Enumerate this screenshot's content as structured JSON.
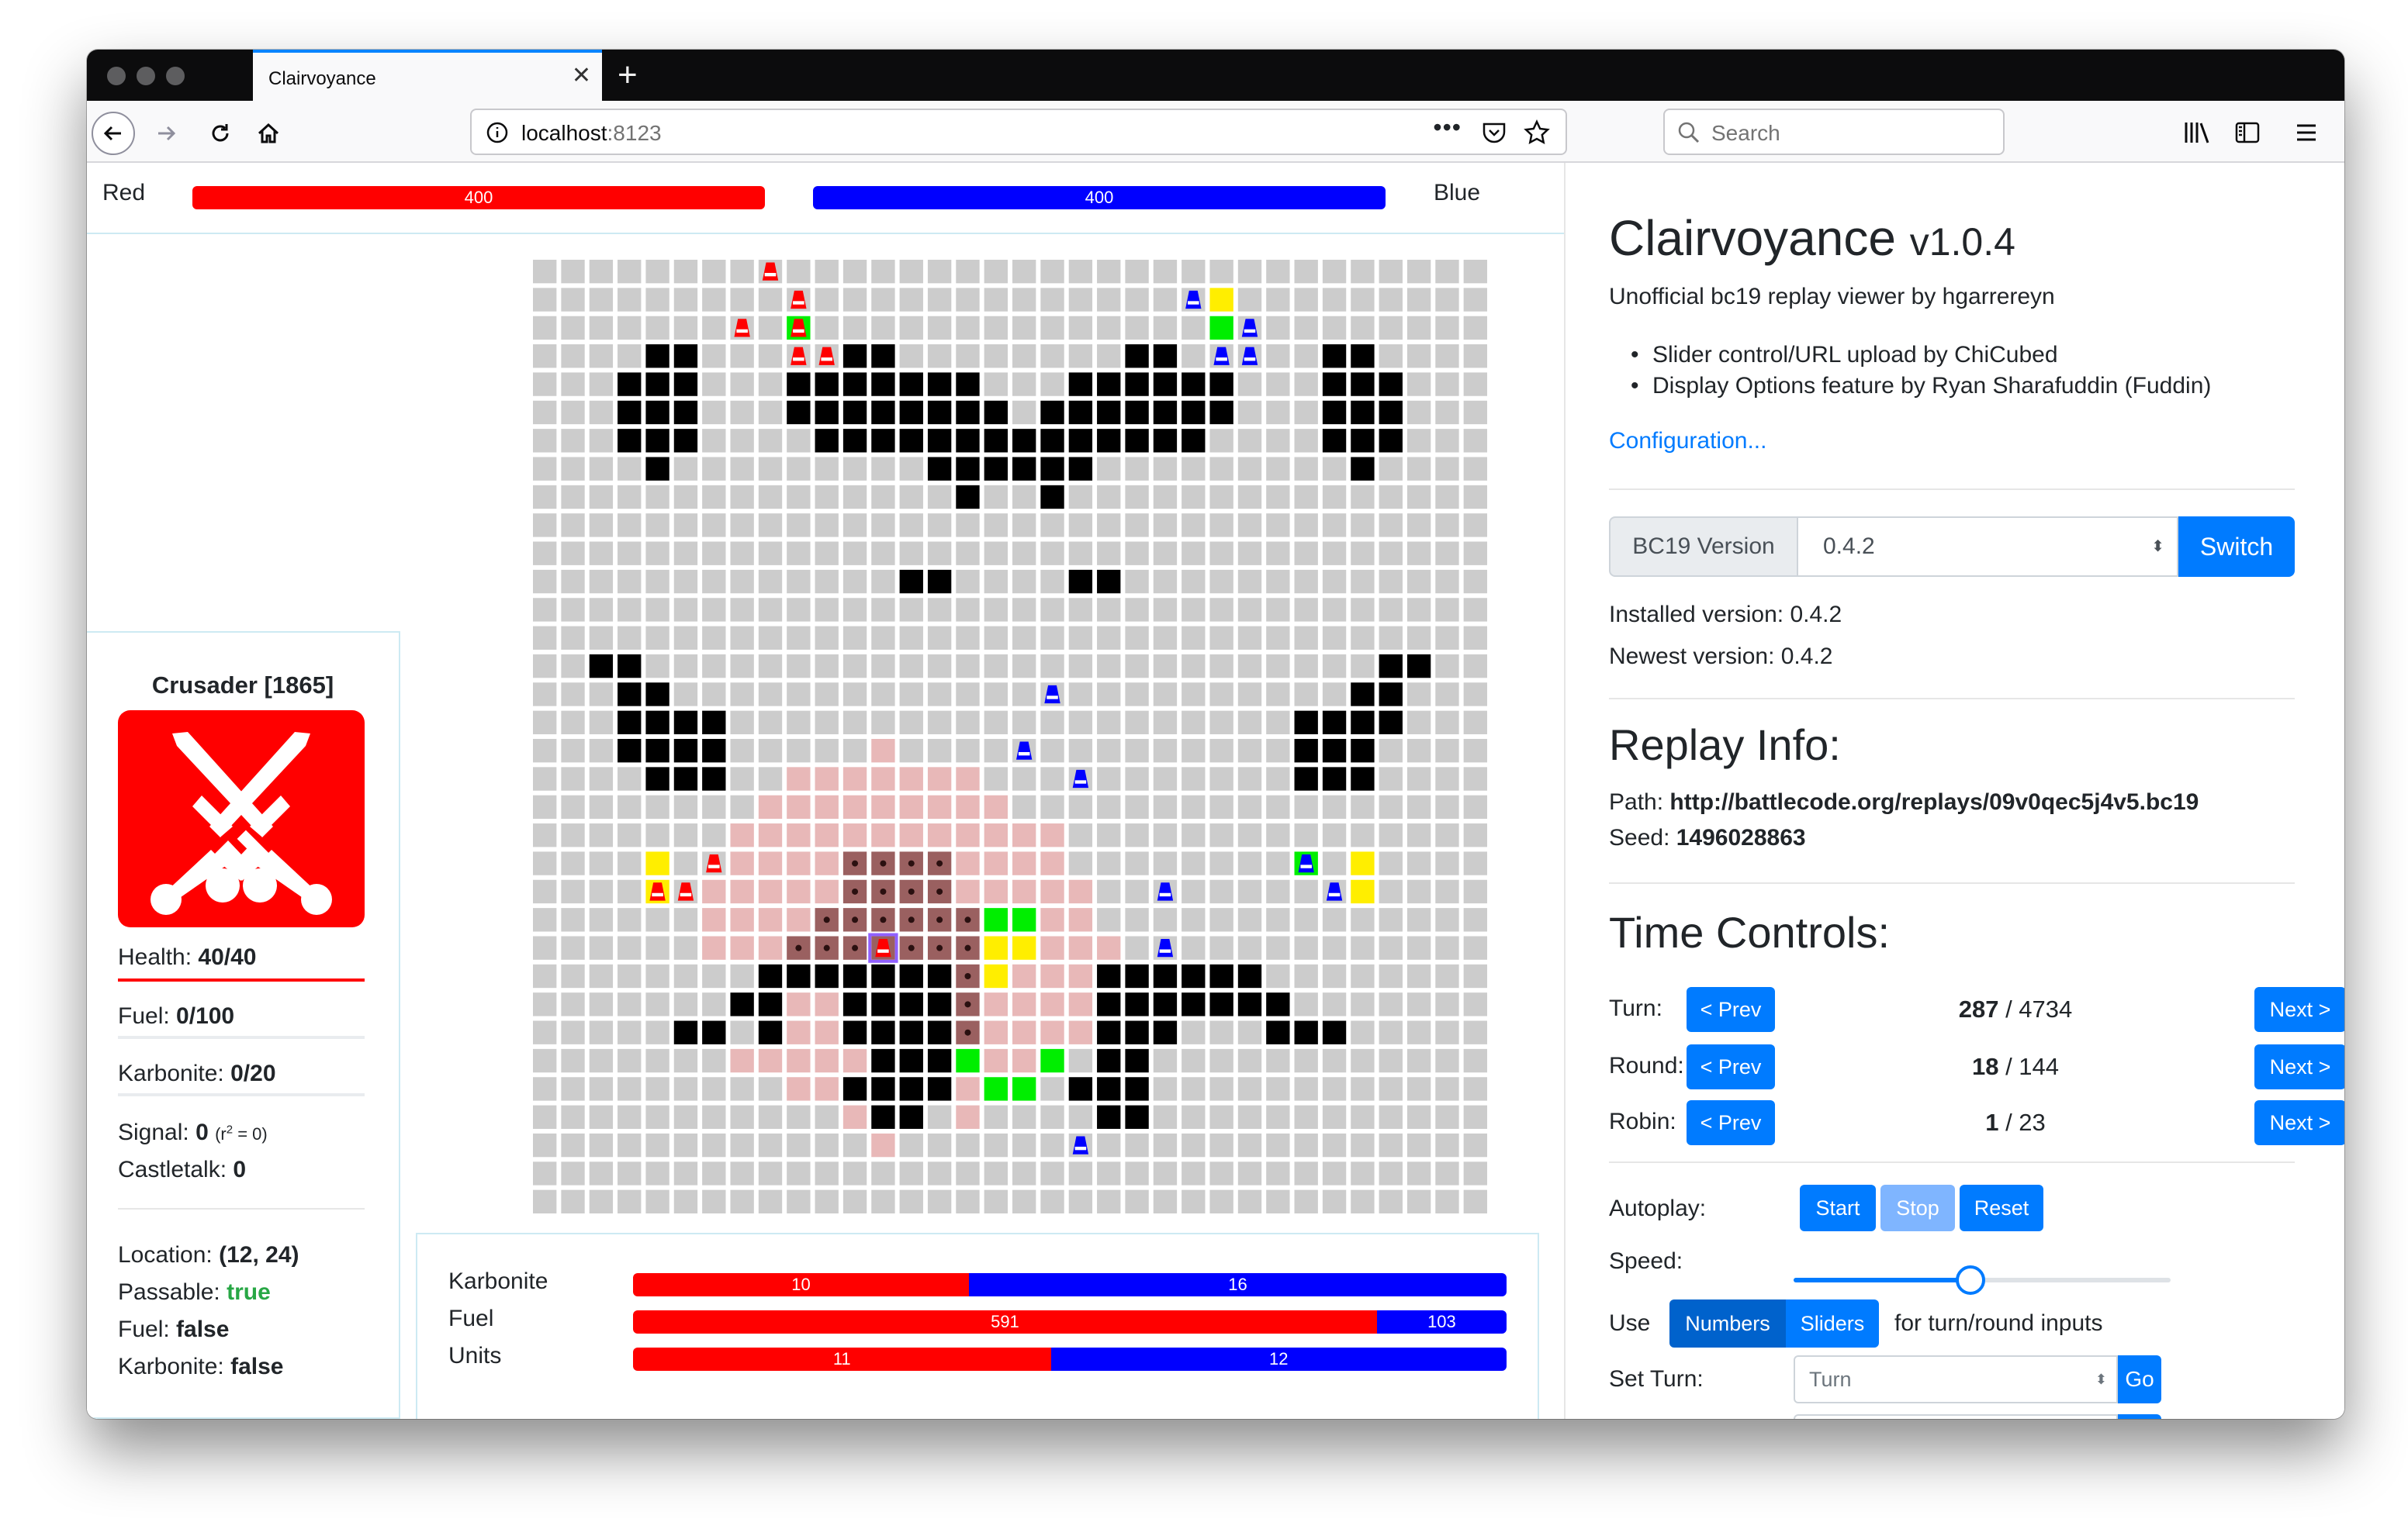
{
  "browser": {
    "tab_title": "Clairvoyance",
    "url_host": "localhost",
    "url_port": ":8123",
    "search_placeholder": "Search",
    "accent": "#0a84ff"
  },
  "health": {
    "red_label": "Red",
    "blue_label": "Blue",
    "red_value": "400",
    "blue_value": "400",
    "red_color": "#ff0000",
    "blue_color": "#0000ff"
  },
  "robot": {
    "title": "Crusader [1865]",
    "icon": "crossed-swords-icon",
    "health_label": "Health:",
    "health_value": "40/40",
    "fuel_label": "Fuel:",
    "fuel_value": "0/100",
    "karbonite_label": "Karbonite:",
    "karbonite_value": "0/20",
    "signal_label": "Signal:",
    "signal_value": "0",
    "signal_note": "(r",
    "signal_note_sup": "2",
    "signal_note_end": " = 0)",
    "castletalk_label": "Castletalk:",
    "castletalk_value": "0",
    "location_label": "Location:",
    "location_value": "(12, 24)",
    "passable_label": "Passable:",
    "passable_value": "true",
    "tile_fuel_label": "Fuel:",
    "tile_fuel_value": "false",
    "tile_karbonite_label": "Karbonite:",
    "tile_karbonite_value": "false"
  },
  "resources": {
    "rows": [
      {
        "label": "Karbonite",
        "red": 10,
        "blue": 16
      },
      {
        "label": "Fuel",
        "red": 591,
        "blue": 103
      },
      {
        "label": "Units",
        "red": 11,
        "blue": 12
      }
    ]
  },
  "map": {
    "size": 34,
    "colors": {
      "empty": "#cccccc",
      "wall": "#000000",
      "red_zone": "#e8b8b8",
      "red_zone_dark": "#9a6060",
      "karbonite": "#00ee00",
      "fuel": "#ffee00",
      "red_unit": "#ff0000",
      "blue_unit": "#0000ff",
      "highlight": "#9060ff"
    },
    "walls": [
      [
        3,
        4
      ],
      [
        3,
        5
      ],
      [
        4,
        3
      ],
      [
        4,
        4
      ],
      [
        4,
        5
      ],
      [
        5,
        3
      ],
      [
        5,
        4
      ],
      [
        5,
        5
      ],
      [
        6,
        3
      ],
      [
        6,
        4
      ],
      [
        6,
        5
      ],
      [
        7,
        4
      ],
      [
        3,
        11
      ],
      [
        3,
        12
      ],
      [
        4,
        9
      ],
      [
        4,
        10
      ],
      [
        4,
        11
      ],
      [
        4,
        12
      ],
      [
        4,
        13
      ],
      [
        4,
        14
      ],
      [
        4,
        15
      ],
      [
        5,
        9
      ],
      [
        5,
        10
      ],
      [
        5,
        11
      ],
      [
        5,
        12
      ],
      [
        5,
        13
      ],
      [
        5,
        14
      ],
      [
        5,
        15
      ],
      [
        5,
        16
      ],
      [
        6,
        10
      ],
      [
        6,
        11
      ],
      [
        6,
        12
      ],
      [
        6,
        13
      ],
      [
        6,
        14
      ],
      [
        6,
        15
      ],
      [
        6,
        16
      ],
      [
        6,
        17
      ],
      [
        7,
        14
      ],
      [
        7,
        15
      ],
      [
        7,
        16
      ],
      [
        7,
        17
      ],
      [
        7,
        18
      ],
      [
        7,
        19
      ],
      [
        8,
        15
      ],
      [
        8,
        18
      ],
      [
        3,
        21
      ],
      [
        3,
        22
      ],
      [
        4,
        19
      ],
      [
        4,
        20
      ],
      [
        4,
        21
      ],
      [
        4,
        22
      ],
      [
        4,
        23
      ],
      [
        4,
        24
      ],
      [
        5,
        18
      ],
      [
        5,
        19
      ],
      [
        5,
        20
      ],
      [
        5,
        21
      ],
      [
        5,
        22
      ],
      [
        5,
        23
      ],
      [
        5,
        24
      ],
      [
        6,
        17
      ],
      [
        6,
        18
      ],
      [
        6,
        19
      ],
      [
        6,
        20
      ],
      [
        6,
        21
      ],
      [
        6,
        22
      ],
      [
        6,
        23
      ],
      [
        3,
        28
      ],
      [
        3,
        29
      ],
      [
        4,
        28
      ],
      [
        4,
        29
      ],
      [
        4,
        30
      ],
      [
        5,
        28
      ],
      [
        5,
        29
      ],
      [
        5,
        30
      ],
      [
        6,
        28
      ],
      [
        6,
        29
      ],
      [
        6,
        30
      ],
      [
        7,
        29
      ],
      [
        11,
        13
      ],
      [
        11,
        14
      ],
      [
        11,
        19
      ],
      [
        11,
        20
      ],
      [
        14,
        2
      ],
      [
        14,
        3
      ],
      [
        15,
        3
      ],
      [
        15,
        4
      ],
      [
        16,
        3
      ],
      [
        16,
        4
      ],
      [
        16,
        5
      ],
      [
        16,
        6
      ],
      [
        17,
        3
      ],
      [
        17,
        4
      ],
      [
        17,
        5
      ],
      [
        17,
        6
      ],
      [
        18,
        4
      ],
      [
        18,
        5
      ],
      [
        18,
        6
      ],
      [
        14,
        30
      ],
      [
        14,
        31
      ],
      [
        15,
        29
      ],
      [
        15,
        30
      ],
      [
        16,
        27
      ],
      [
        16,
        28
      ],
      [
        16,
        29
      ],
      [
        16,
        30
      ],
      [
        17,
        27
      ],
      [
        17,
        28
      ],
      [
        17,
        29
      ],
      [
        18,
        27
      ],
      [
        18,
        28
      ],
      [
        18,
        29
      ],
      [
        25,
        8
      ],
      [
        25,
        9
      ],
      [
        25,
        10
      ],
      [
        25,
        11
      ],
      [
        25,
        12
      ],
      [
        25,
        13
      ],
      [
        25,
        14
      ],
      [
        26,
        7
      ],
      [
        26,
        8
      ],
      [
        26,
        11
      ],
      [
        26,
        12
      ],
      [
        26,
        13
      ],
      [
        26,
        14
      ],
      [
        27,
        5
      ],
      [
        27,
        6
      ],
      [
        27,
        8
      ],
      [
        27,
        11
      ],
      [
        27,
        12
      ],
      [
        27,
        13
      ],
      [
        27,
        14
      ],
      [
        28,
        12
      ],
      [
        28,
        13
      ],
      [
        28,
        14
      ],
      [
        29,
        11
      ],
      [
        29,
        12
      ],
      [
        29,
        13
      ],
      [
        29,
        14
      ],
      [
        30,
        12
      ],
      [
        30,
        13
      ],
      [
        25,
        20
      ],
      [
        25,
        21
      ],
      [
        25,
        22
      ],
      [
        25,
        23
      ],
      [
        25,
        24
      ],
      [
        25,
        25
      ],
      [
        26,
        20
      ],
      [
        26,
        21
      ],
      [
        26,
        22
      ],
      [
        26,
        23
      ],
      [
        26,
        24
      ],
      [
        26,
        25
      ],
      [
        26,
        26
      ],
      [
        27,
        20
      ],
      [
        27,
        21
      ],
      [
        27,
        22
      ],
      [
        27,
        26
      ],
      [
        27,
        27
      ],
      [
        27,
        28
      ],
      [
        28,
        20
      ],
      [
        28,
        21
      ],
      [
        29,
        19
      ],
      [
        29,
        20
      ],
      [
        29,
        21
      ],
      [
        30,
        20
      ],
      [
        30,
        21
      ]
    ],
    "red_zone": [
      [
        17,
        12
      ],
      [
        18,
        9
      ],
      [
        18,
        10
      ],
      [
        18,
        11
      ],
      [
        18,
        12
      ],
      [
        18,
        13
      ],
      [
        18,
        14
      ],
      [
        18,
        15
      ],
      [
        19,
        8
      ],
      [
        19,
        9
      ],
      [
        19,
        10
      ],
      [
        19,
        11
      ],
      [
        19,
        12
      ],
      [
        19,
        13
      ],
      [
        19,
        14
      ],
      [
        19,
        15
      ],
      [
        19,
        16
      ],
      [
        20,
        7
      ],
      [
        20,
        8
      ],
      [
        20,
        9
      ],
      [
        20,
        10
      ],
      [
        20,
        11
      ],
      [
        20,
        12
      ],
      [
        20,
        13
      ],
      [
        20,
        14
      ],
      [
        20,
        15
      ],
      [
        20,
        16
      ],
      [
        20,
        17
      ],
      [
        20,
        18
      ],
      [
        21,
        7
      ],
      [
        21,
        8
      ],
      [
        21,
        9
      ],
      [
        21,
        10
      ],
      [
        21,
        15
      ],
      [
        21,
        16
      ],
      [
        21,
        17
      ],
      [
        21,
        18
      ],
      [
        22,
        6
      ],
      [
        22,
        7
      ],
      [
        22,
        8
      ],
      [
        22,
        9
      ],
      [
        22,
        10
      ],
      [
        22,
        15
      ],
      [
        22,
        16
      ],
      [
        22,
        17
      ],
      [
        22,
        18
      ],
      [
        22,
        19
      ],
      [
        23,
        6
      ],
      [
        23,
        7
      ],
      [
        23,
        8
      ],
      [
        23,
        9
      ],
      [
        23,
        16
      ],
      [
        23,
        17
      ],
      [
        23,
        18
      ],
      [
        23,
        19
      ],
      [
        24,
        6
      ],
      [
        24,
        7
      ],
      [
        24,
        8
      ],
      [
        24,
        16
      ],
      [
        24,
        17
      ],
      [
        24,
        18
      ],
      [
        24,
        19
      ],
      [
        24,
        20
      ],
      [
        25,
        15
      ],
      [
        25,
        16
      ],
      [
        25,
        17
      ],
      [
        25,
        18
      ],
      [
        25,
        19
      ],
      [
        26,
        9
      ],
      [
        26,
        10
      ],
      [
        26,
        15
      ],
      [
        26,
        16
      ],
      [
        26,
        17
      ],
      [
        26,
        18
      ],
      [
        26,
        19
      ],
      [
        27,
        9
      ],
      [
        27,
        10
      ],
      [
        27,
        15
      ],
      [
        27,
        16
      ],
      [
        27,
        17
      ],
      [
        27,
        18
      ],
      [
        27,
        19
      ],
      [
        28,
        7
      ],
      [
        28,
        8
      ],
      [
        28,
        9
      ],
      [
        28,
        10
      ],
      [
        28,
        11
      ],
      [
        28,
        15
      ],
      [
        28,
        16
      ],
      [
        28,
        17
      ],
      [
        28,
        18
      ],
      [
        29,
        9
      ],
      [
        29,
        10
      ],
      [
        29,
        15
      ],
      [
        29,
        16
      ],
      [
        30,
        11
      ],
      [
        30,
        15
      ],
      [
        31,
        12
      ]
    ],
    "red_zone_dark": [
      [
        21,
        11
      ],
      [
        21,
        12
      ],
      [
        21,
        13
      ],
      [
        21,
        14
      ],
      [
        22,
        11
      ],
      [
        22,
        12
      ],
      [
        22,
        13
      ],
      [
        22,
        14
      ],
      [
        23,
        10
      ],
      [
        23,
        11
      ],
      [
        23,
        12
      ],
      [
        23,
        13
      ],
      [
        23,
        14
      ],
      [
        23,
        15
      ],
      [
        24,
        9
      ],
      [
        24,
        10
      ],
      [
        24,
        11
      ],
      [
        24,
        12
      ],
      [
        24,
        13
      ],
      [
        24,
        14
      ],
      [
        24,
        15
      ],
      [
        25,
        15
      ],
      [
        26,
        15
      ],
      [
        27,
        15
      ]
    ],
    "karbonite": [
      [
        2,
        9
      ],
      [
        2,
        24
      ],
      [
        23,
        16
      ],
      [
        23,
        17
      ],
      [
        28,
        15
      ],
      [
        28,
        18
      ],
      [
        29,
        16
      ],
      [
        29,
        17
      ],
      [
        21,
        27
      ]
    ],
    "fuel": [
      [
        1,
        24
      ],
      [
        2,
        24
      ],
      [
        21,
        4
      ],
      [
        22,
        4
      ],
      [
        24,
        16
      ],
      [
        24,
        17
      ],
      [
        25,
        16
      ],
      [
        21,
        29
      ],
      [
        22,
        29
      ]
    ],
    "red_units": [
      [
        0,
        8
      ],
      [
        1,
        9
      ],
      [
        2,
        7
      ],
      [
        2,
        9
      ],
      [
        3,
        9
      ],
      [
        3,
        10
      ],
      [
        21,
        6
      ],
      [
        22,
        4
      ],
      [
        22,
        5
      ],
      [
        24,
        12
      ]
    ],
    "blue_units": [
      [
        1,
        23
      ],
      [
        2,
        25
      ],
      [
        3,
        24
      ],
      [
        3,
        25
      ],
      [
        15,
        18
      ],
      [
        17,
        17
      ],
      [
        18,
        19
      ],
      [
        22,
        22
      ],
      [
        21,
        27
      ],
      [
        22,
        28
      ],
      [
        24,
        22
      ],
      [
        31,
        19
      ]
    ],
    "selected": [
      24,
      12
    ]
  },
  "app": {
    "title": "Clairvoyance",
    "version": "v1.0.4",
    "subtitle": "Unofficial bc19 replay viewer by hgarrereyn",
    "credits": [
      "Slider control/URL upload by ChiCubed",
      "Display Options feature by Ryan Sharafuddin (Fuddin)"
    ],
    "config_link": "Configuration..."
  },
  "bc19": {
    "label": "BC19 Version",
    "selected": "0.4.2",
    "switch_label": "Switch",
    "installed": "Installed version: 0.4.2",
    "newest": "Newest version: 0.4.2"
  },
  "replay": {
    "heading": "Replay Info:",
    "path_label": "Path: ",
    "path_value": "http://battlecode.org/replays/09v0qec5j4v5.bc19",
    "seed_label": "Seed: ",
    "seed_value": "1496028863"
  },
  "time": {
    "heading": "Time Controls:",
    "rows": [
      {
        "label": "Turn:",
        "current": "287",
        "total": " / 4734"
      },
      {
        "label": "Round:",
        "current": "18",
        "total": " / 144"
      },
      {
        "label": "Robin:",
        "current": "1",
        "total": " / 23"
      }
    ],
    "prev_label": "< Prev",
    "next_label": "Next >"
  },
  "autoplay": {
    "label": "Autoplay:",
    "start": "Start",
    "stop": "Stop",
    "reset": "Reset",
    "speed_label": "Speed:",
    "speed_fraction": 0.47,
    "use_label": "Use",
    "numbers": "Numbers",
    "sliders": "Sliders",
    "use_suffix": "for turn/round inputs",
    "set_turn_label": "Set Turn:",
    "turn_placeholder": "Turn",
    "go": "Go"
  }
}
